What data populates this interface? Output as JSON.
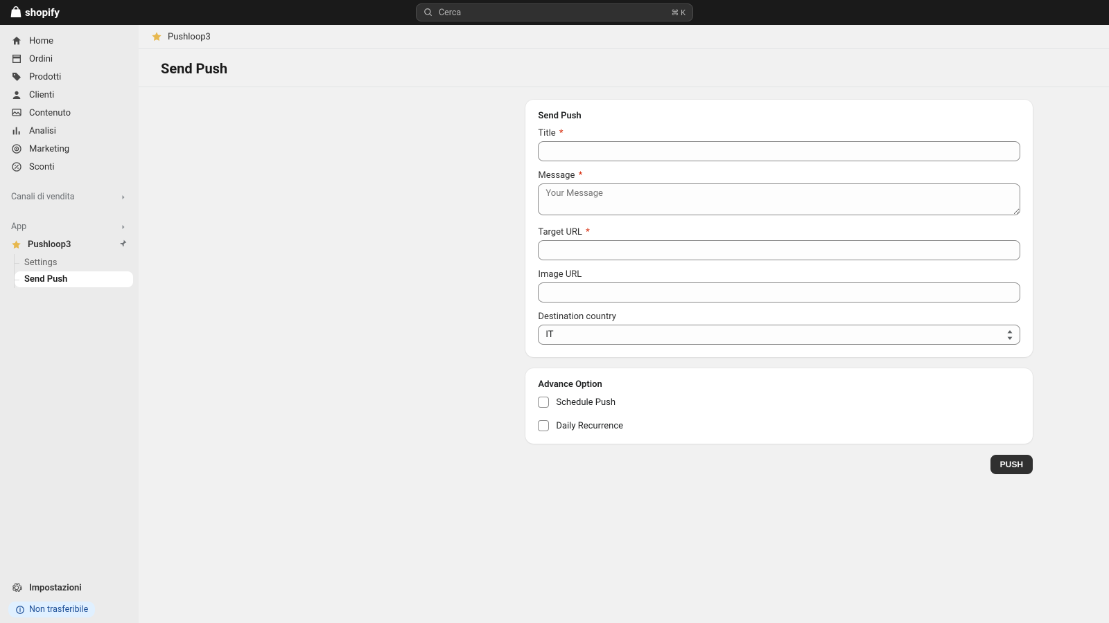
{
  "brand": "shopify",
  "search": {
    "placeholder": "Cerca",
    "shortcut": "⌘ K"
  },
  "sidebar": {
    "items": [
      {
        "label": "Home",
        "icon": "home-icon"
      },
      {
        "label": "Ordini",
        "icon": "orders-icon"
      },
      {
        "label": "Prodotti",
        "icon": "products-icon"
      },
      {
        "label": "Clienti",
        "icon": "customers-icon"
      },
      {
        "label": "Contenuto",
        "icon": "content-icon"
      },
      {
        "label": "Analisi",
        "icon": "analytics-icon"
      },
      {
        "label": "Marketing",
        "icon": "marketing-icon"
      },
      {
        "label": "Sconti",
        "icon": "discounts-icon"
      }
    ],
    "section_sales": "Canali di vendita",
    "section_app": "App",
    "app": {
      "name": "Pushloop3",
      "sub": [
        {
          "label": "Settings",
          "active": false
        },
        {
          "label": "Send Push",
          "active": true
        }
      ]
    },
    "settings_label": "Impostazioni",
    "pill_label": "Non trasferibile"
  },
  "breadcrumb": {
    "app": "Pushloop3"
  },
  "page": {
    "title": "Send Push"
  },
  "form": {
    "card_title": "Send Push",
    "fields": {
      "title": {
        "label": "Title",
        "required": true,
        "value": "",
        "placeholder": ""
      },
      "message": {
        "label": "Message",
        "required": true,
        "value": "",
        "placeholder": "Your Message"
      },
      "targetUrl": {
        "label": "Target URL",
        "required": true,
        "value": "",
        "placeholder": ""
      },
      "imageUrl": {
        "label": "Image URL",
        "required": false,
        "value": "",
        "placeholder": ""
      },
      "country": {
        "label": "Destination country",
        "value": "IT"
      }
    },
    "advance": {
      "title": "Advance Option",
      "schedule": {
        "label": "Schedule Push",
        "checked": false
      },
      "daily": {
        "label": "Daily Recurrence",
        "checked": false
      }
    },
    "submit_label": "PUSH"
  },
  "required_marker": "*"
}
